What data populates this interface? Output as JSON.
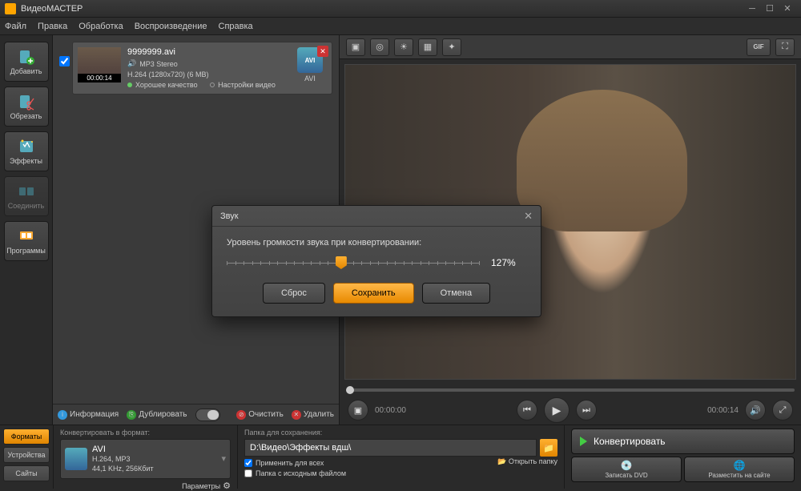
{
  "app": {
    "title": "ВидеоМАСТЕР"
  },
  "menu": [
    "Файл",
    "Правка",
    "Обработка",
    "Воспроизведение",
    "Справка"
  ],
  "sidebar": [
    {
      "label": "Добавить",
      "disabled": false
    },
    {
      "label": "Обрезать",
      "disabled": false
    },
    {
      "label": "Эффекты",
      "disabled": false
    },
    {
      "label": "Соединить",
      "disabled": true
    },
    {
      "label": "Программы",
      "disabled": false
    }
  ],
  "file": {
    "name": "9999999.avi",
    "audio": "MP3 Stereo",
    "codec": "H.264 (1280x720) (6 MB)",
    "duration": "00:00:14",
    "quality": "Хорошее качество",
    "settings": "Настройки видео",
    "format_label": "AVI"
  },
  "list_footer": {
    "info": "Информация",
    "dup": "Дублировать",
    "clear": "Очистить",
    "del": "Удалить"
  },
  "preview": {
    "gif_label": "GIF",
    "time_start": "00:00:00",
    "time_end": "00:00:14"
  },
  "bottom": {
    "tabs": [
      "Форматы",
      "Устройства",
      "Сайты"
    ],
    "active_tab": 0,
    "format_label": "Конвертировать в формат:",
    "format_name": "AVI",
    "format_detail": "H.264, MP3\n44,1 KHz, 256Кбит",
    "params": "Параметры",
    "path_label": "Папка для сохранения:",
    "path_value": "D:\\Видео\\Эффекты вдш\\",
    "open_folder": "Открыть папку",
    "chk_all": "Применить для всех",
    "chk_src": "Папка с исходным файлом",
    "convert": "Конвертировать",
    "dvd": "Записать DVD",
    "site": "Разместить на сайте"
  },
  "dialog": {
    "title": "Звук",
    "label": "Уровень громкости звука при конвертировании:",
    "value": "127%",
    "reset": "Сброс",
    "save": "Сохранить",
    "cancel": "Отмена"
  }
}
